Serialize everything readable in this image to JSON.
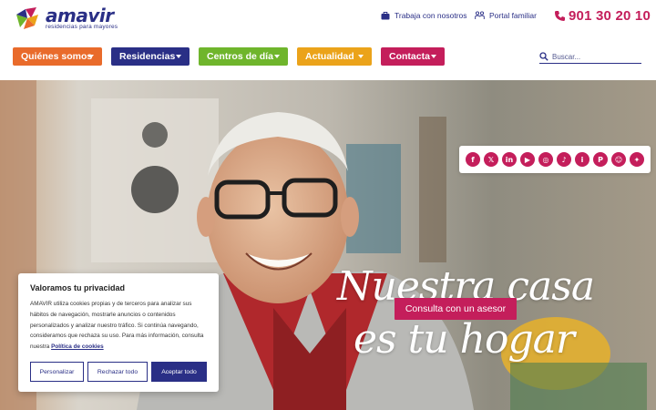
{
  "brand": {
    "name": "amavir",
    "tagline": "residencias para mayores",
    "colors": {
      "navy": "#2a2f86",
      "magenta": "#c41e5b",
      "orange": "#e96b2b",
      "green": "#6fb52c",
      "yellow": "#eba31a"
    }
  },
  "utility": {
    "work_label": "Trabaja con nosotros",
    "work_icon": "briefcase-icon",
    "portal_label": "Portal familiar",
    "portal_icon": "family-icon",
    "phone": "901 30 20 10",
    "phone_icon": "phone-icon"
  },
  "nav": {
    "quienes": "Quiénes somos",
    "residencias": "Residencias",
    "centros": "Centros de día",
    "actualidad": "Actualidad",
    "contacta": "Contacta"
  },
  "search": {
    "placeholder": "Buscar..."
  },
  "social": [
    {
      "icon": "facebook-icon",
      "glyph": "f"
    },
    {
      "icon": "x-icon",
      "glyph": "𝕏"
    },
    {
      "icon": "linkedin-icon",
      "glyph": "in"
    },
    {
      "icon": "youtube-icon",
      "glyph": "▶"
    },
    {
      "icon": "instagram-icon",
      "glyph": "◎"
    },
    {
      "icon": "tiktok-icon",
      "glyph": "♪"
    },
    {
      "icon": "info-icon",
      "glyph": "i"
    },
    {
      "icon": "pinterest-icon",
      "glyph": "P"
    },
    {
      "icon": "snapchat-icon",
      "glyph": "☺"
    },
    {
      "icon": "bluesky-icon",
      "glyph": "✦"
    }
  ],
  "hero": {
    "headline_line1": "Nuestra casa",
    "headline_line2": "es tu hogar",
    "cta": "Consulta con un asesor"
  },
  "cookie": {
    "title": "Valoramos tu privacidad",
    "body": "AMAVIR utiliza cookies propias y de terceros para analizar sus hábitos de navegación, mostrarle anuncios o contenidos personalizados y analizar nuestro tráfico. Si continúa navegando, consideramos que rechaza su uso. Para más información, consulta nuestra ",
    "link": "Política de cookies",
    "personalizar": "Personalizar",
    "rechazar": "Rechazar todo",
    "aceptar": "Aceptar todo"
  }
}
